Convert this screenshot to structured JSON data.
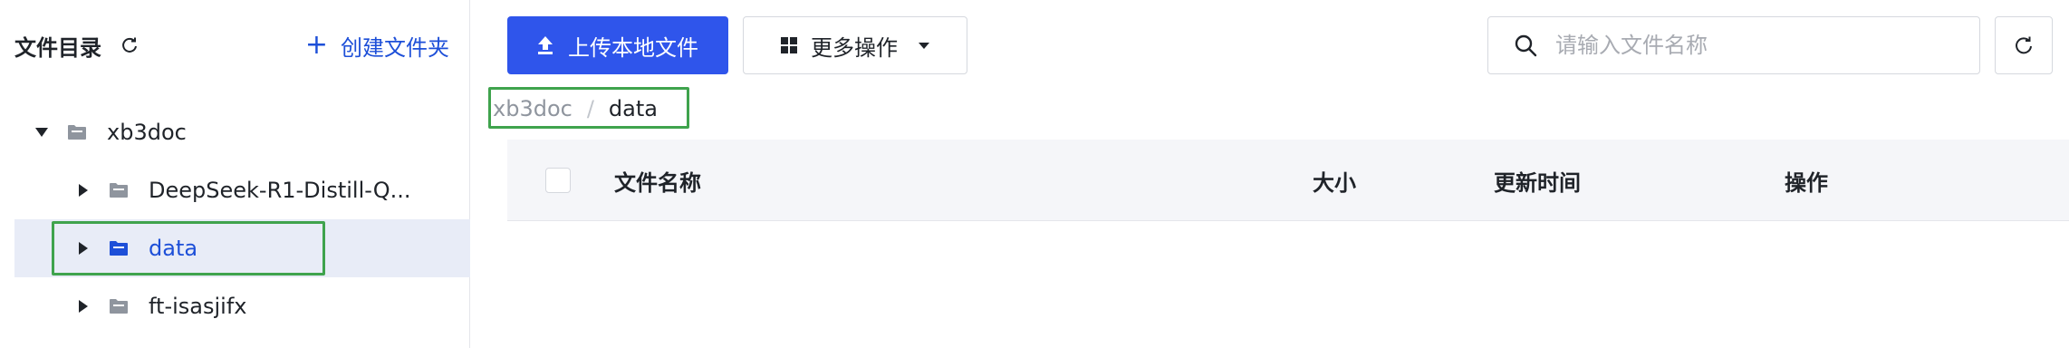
{
  "sidebar": {
    "title": "文件目录",
    "create_folder_label": "创建文件夹",
    "tree": [
      {
        "label": "xb3doc",
        "level": 0,
        "expanded": true,
        "selected": false
      },
      {
        "label": "DeepSeek-R1-Distill-Q...",
        "level": 1,
        "expanded": false,
        "selected": false
      },
      {
        "label": "data",
        "level": 1,
        "expanded": false,
        "selected": true
      },
      {
        "label": "ft-isasjifx",
        "level": 1,
        "expanded": false,
        "selected": false
      }
    ]
  },
  "toolbar": {
    "upload_label": "上传本地文件",
    "more_label": "更多操作",
    "search_placeholder": "请输入文件名称"
  },
  "breadcrumb": {
    "root": "xb3doc",
    "separator": "/",
    "current": "data"
  },
  "table": {
    "columns": [
      "文件名称",
      "大小",
      "更新时间",
      "操作"
    ]
  },
  "colors": {
    "primary": "#2f55eb",
    "link": "#1d4fd8",
    "highlight_box": "#3fa34d",
    "selected_row_bg": "#e8ecf7"
  },
  "icons": [
    "refresh-icon",
    "plus-icon",
    "caret-down-icon",
    "caret-right-icon",
    "folder-icon",
    "upload-icon",
    "grid-icon",
    "dropdown-arrow-icon",
    "search-icon"
  ]
}
